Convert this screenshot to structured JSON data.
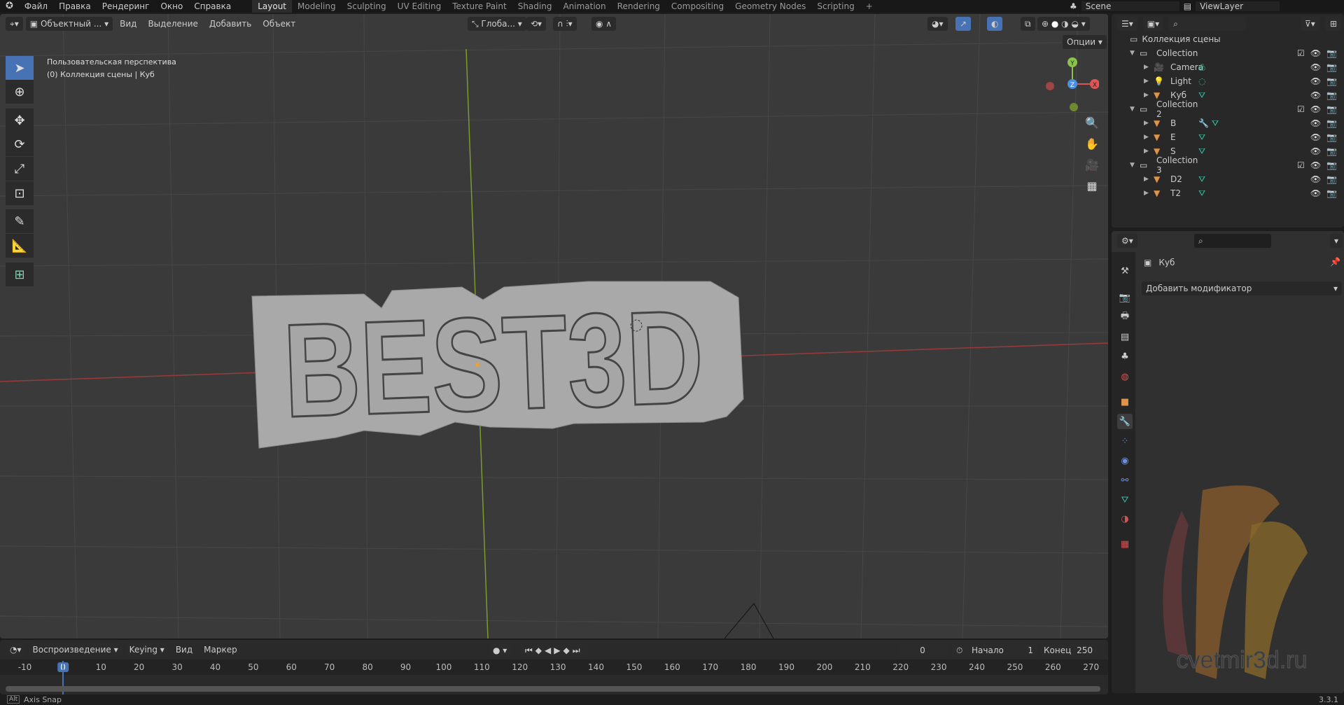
{
  "topbar": {
    "menus": [
      "Файл",
      "Правка",
      "Рендеринг",
      "Окно",
      "Справка"
    ],
    "workspaces": [
      "Layout",
      "Modeling",
      "Sculpting",
      "UV Editing",
      "Texture Paint",
      "Shading",
      "Animation",
      "Rendering",
      "Compositing",
      "Geometry Nodes",
      "Scripting"
    ],
    "active_workspace": "Layout",
    "add": "+",
    "scene": "Scene",
    "view_layer": "ViewLayer"
  },
  "viewport": {
    "mode": "Объектный ...",
    "menus": [
      "Вид",
      "Выделение",
      "Добавить",
      "Объект"
    ],
    "orientation": "Глоба...",
    "options": "Опции",
    "overlay_line1": "Пользовательская перспектива",
    "overlay_line2": "(0) Коллекция сцены | Куб",
    "model_text": "BEST3D",
    "gizmo": {
      "x": "X",
      "y": "Y",
      "z": "Z"
    },
    "accent": "#4772b3"
  },
  "outliner": {
    "root": "Коллекция сцены",
    "rows": [
      {
        "name": "Collection",
        "type": "collection",
        "level": 0
      },
      {
        "name": "Camera",
        "type": "camera",
        "level": 1
      },
      {
        "name": "Light",
        "type": "light",
        "level": 1
      },
      {
        "name": "Куб",
        "type": "mesh",
        "level": 1
      },
      {
        "name": "Collection 2",
        "type": "collection",
        "level": 0
      },
      {
        "name": "B",
        "type": "mesh",
        "level": 1,
        "modifier": true
      },
      {
        "name": "E",
        "type": "mesh",
        "level": 1
      },
      {
        "name": "S",
        "type": "mesh",
        "level": 1
      },
      {
        "name": "Collection 3",
        "type": "collection",
        "level": 0
      },
      {
        "name": "D2",
        "type": "mesh",
        "level": 1
      },
      {
        "name": "T2",
        "type": "mesh",
        "level": 1
      }
    ]
  },
  "properties": {
    "object_name": "Куб",
    "add_modifier": "Добавить модификатор",
    "tabs": [
      "tool",
      "render",
      "output",
      "view-layer",
      "scene",
      "world",
      "object",
      "modifiers",
      "particles",
      "physics",
      "constraints",
      "data",
      "material",
      "texture"
    ],
    "active_tab": "modifiers"
  },
  "timeline": {
    "menus": [
      "Воспроизведение",
      "Keying",
      "Вид",
      "Маркер"
    ],
    "current_frame": "0",
    "start_label": "Начало",
    "start": "1",
    "end_label": "Конец",
    "end": "250",
    "ticks": [
      "-10",
      "0",
      "10",
      "20",
      "30",
      "40",
      "50",
      "60",
      "70",
      "80",
      "90",
      "100",
      "110",
      "120",
      "130",
      "140",
      "150",
      "160",
      "170",
      "180",
      "190",
      "200",
      "210",
      "220",
      "230",
      "240",
      "250",
      "260",
      "270"
    ]
  },
  "status": {
    "key": "Alt",
    "hint": "Axis Snap",
    "version": "3.3.1"
  },
  "watermark": "cvetmir3d.ru"
}
